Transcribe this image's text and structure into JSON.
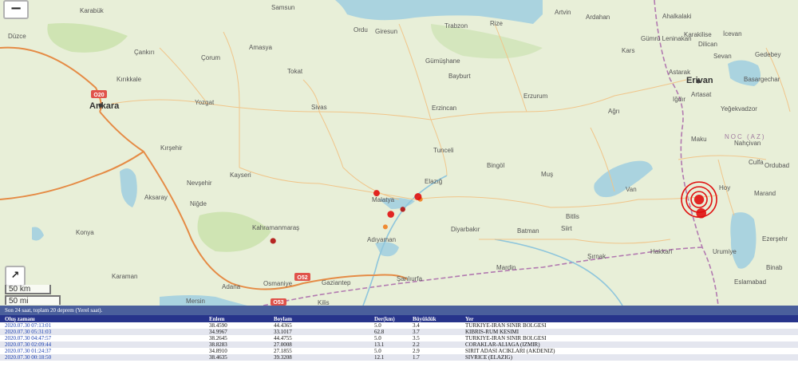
{
  "map": {
    "zoom_out_label": "−",
    "expand_icon": "↗",
    "scale_km": "50 km",
    "scale_mi": "50 mi",
    "labels": {
      "ankara": "Ankara",
      "erivan": "Erivan",
      "karabuk": "Karabük",
      "duzce": "Düzce",
      "samsun": "Samsun",
      "ordu": "Ordu",
      "giresun": "Giresun",
      "trabzon": "Trabzon",
      "rize": "Rize",
      "artvin": "Artvin",
      "ardahan": "Ardahan",
      "cankiri": "Çankırı",
      "corum": "Çorum",
      "amasya": "Amasya",
      "gumushane": "Gümüşhane",
      "tokat": "Tokat",
      "bayburt": "Bayburt",
      "erzurum": "Erzurum",
      "kirikkale": "Kırıkkale",
      "yozgat": "Yozgat",
      "sivas": "Sivas",
      "erzincan": "Erzincan",
      "agri": "Ağrı",
      "igdir": "Iğdır",
      "kirsehir": "Kırşehir",
      "tunceli": "Tunceli",
      "bingol": "Bingöl",
      "mus": "Muş",
      "kayseri": "Kayseri",
      "nevsehir": "Nevşehir",
      "elazig": "Elazığ",
      "malatya": "Malatya",
      "aksaray": "Aksaray",
      "nigde": "Niğde",
      "bitlis": "Bitlis",
      "van": "Van",
      "hoy": "Hoy",
      "konya": "Konya",
      "kahramanmaras": "Kahramanmaraş",
      "adiyaman": "Adıyaman",
      "diyarbakir": "Diyarbakır",
      "batman": "Batman",
      "siirt": "Siirt",
      "sirnak": "Şırnak",
      "hakkari": "Hakkari",
      "urumiye": "Urumiye",
      "karaman": "Karaman",
      "mardin": "Mardin",
      "adana": "Adana",
      "osmaniye": "Osmaniye",
      "gaziantep": "Gaziantep",
      "sanliurfa": "Şanlıurfa",
      "mersin": "Mersin",
      "kilis": "Kilis",
      "kars": "Kars",
      "gumru": "Gümrü Leninakan",
      "ahalkalaki": "Ahalkalaki",
      "karakilise": "Karakilise",
      "ijevan": "İcevan",
      "dilican": "Dilican",
      "gedebey": "Gedebey",
      "sevan": "Sevan",
      "basargechar": "Basargechar",
      "astarak": "Astarak",
      "artasat": "Artasat",
      "yeghegnadzor": "Yeğekvadzor",
      "maku": "Maku",
      "nahcivan": "Nahçivan",
      "culfa": "Culfa",
      "ordubad": "Ordubad",
      "marand": "Marand",
      "ezersehr": "Ezerşehr",
      "binab": "Binab",
      "eslamabad": "Eslamabad",
      "noc": "NOC (AZ)"
    },
    "road_o20": "O20",
    "road_o52": "O52",
    "road_o53": "O53",
    "quakes": [
      {
        "lat": 38.459,
        "lon": 44.4365,
        "mag": 3.4,
        "featured": true
      },
      {
        "lat": 38.2645,
        "lon": 44.4755,
        "mag": 3.5
      },
      {
        "lat": 38.4635,
        "lon": 39.3208,
        "mag": 1.7
      },
      {
        "lat": 38.5,
        "lon": 39.28,
        "mag": 2.5
      },
      {
        "lat": 38.55,
        "lon": 38.52,
        "mag": 2.2
      },
      {
        "lat": 38.25,
        "lon": 38.78,
        "mag": 2.4
      },
      {
        "lat": 38.32,
        "lon": 39.0,
        "mag": 1.8
      },
      {
        "lat": 38.07,
        "lon": 38.68,
        "mag": 1.5
      },
      {
        "lat": 37.87,
        "lon": 36.62,
        "mag": 2.0
      }
    ]
  },
  "panel": {
    "title": "Son 24 saat, toplam 20 deprem (Yerel saat).",
    "headers": [
      "Oluş zamanı",
      "Enlem",
      "Boylam",
      "Der(km)",
      "Büyüklük",
      "Yer"
    ],
    "rows": [
      [
        "2020.07.30 07:13:01",
        "38.4590",
        "44.4365",
        "5.0",
        "3.4",
        "TURKIYE-IRAN SINIR BOLGESI"
      ],
      [
        "2020.07.30 05:31:03",
        "34.9967",
        "33.1017",
        "62.8",
        "3.7",
        "KIBRIS-RUM KESIMI"
      ],
      [
        "2020.07.30 04:47:57",
        "38.2645",
        "44.4755",
        "5.0",
        "3.5",
        "TURKIYE-IRAN SINIR BOLGESI"
      ],
      [
        "2020.07.30 02:09:44",
        "38.8283",
        "27.0008",
        "13.1",
        "2.2",
        "CORAKLAR-ALIAGA (IZMIR)"
      ],
      [
        "2020.07.30 01:24:37",
        "34.8910",
        "27.1855",
        "5.0",
        "2.9",
        "SIRIT ADASI ACIKLARI (AKDENIZ)"
      ],
      [
        "2020.07.30 00:18:50",
        "38.4635",
        "39.3208",
        "12.1",
        "1.7",
        "SIVRICE (ELAZIG)"
      ]
    ]
  }
}
